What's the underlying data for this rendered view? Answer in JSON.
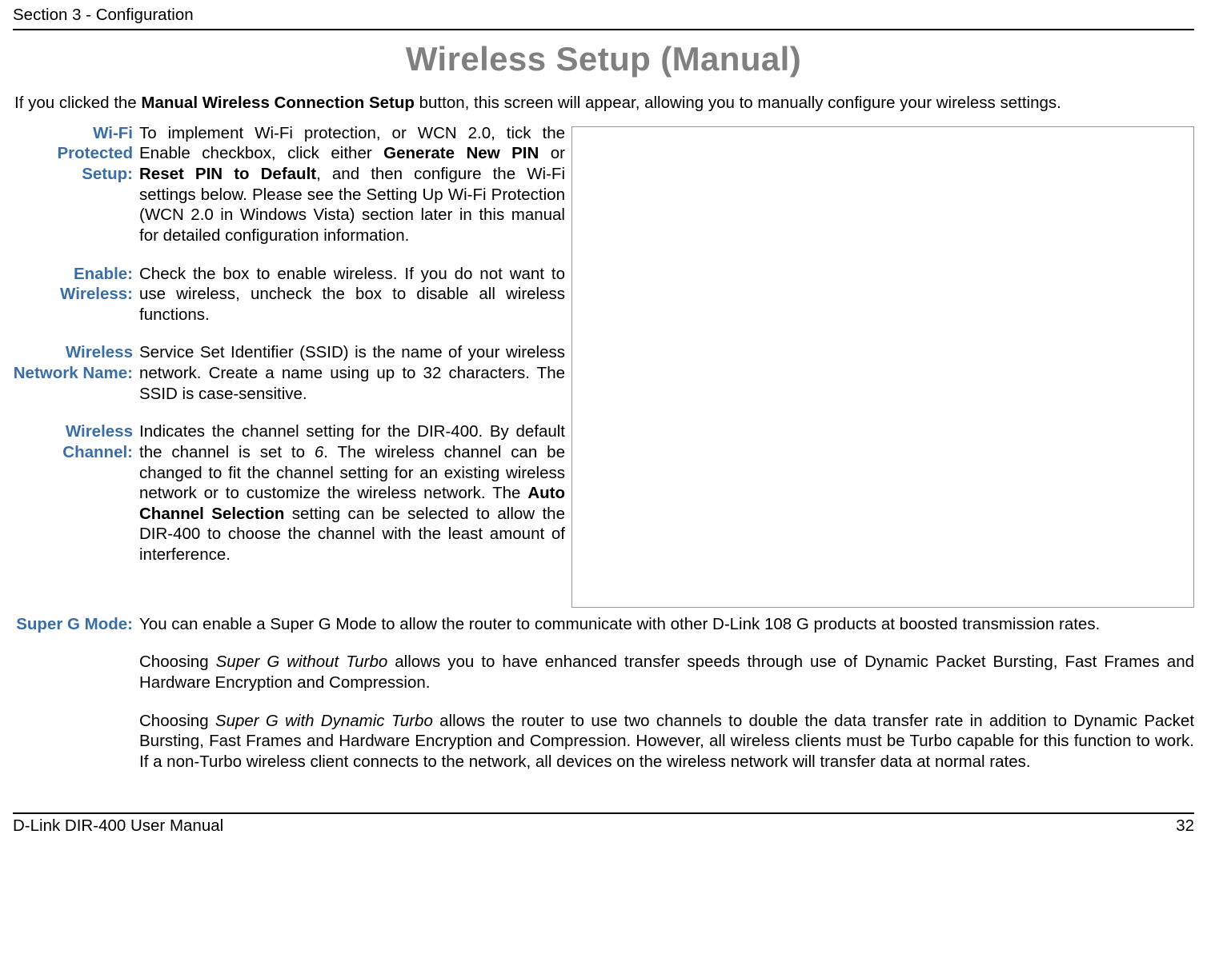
{
  "header": {
    "section": "Section 3 - Configuration"
  },
  "title": "Wireless Setup (Manual)",
  "intro_pre": "If you clicked the ",
  "intro_bold": "Manual Wireless Connection Setup",
  "intro_post": " button, this screen will appear, allowing you to manually configure your wireless settings.",
  "defs": {
    "wifi_protected": {
      "label1": "Wi-Fi Protected",
      "label2": "Setup:",
      "body_pre": "To implement Wi-Fi protection, or WCN 2.0, tick the Enable checkbox, click either ",
      "body_b1": "Generate New PIN",
      "body_mid1": " or ",
      "body_b2": "Reset PIN to Default",
      "body_post": ", and then configure the Wi-Fi settings below. Please see the Setting Up Wi-Fi Protection (WCN 2.0 in Windows Vista) section later in this manual for detailed configuration information."
    },
    "enable": {
      "label1": "Enable:",
      "label2": "Wireless:",
      "body": "Check the box to enable wireless. If you do not want to use wireless, uncheck the box to disable all wireless functions."
    },
    "netname": {
      "label1": "Wireless",
      "label2": "Network Name:",
      "body": "Service Set Identifier (SSID) is the name of your wireless network. Create a name using up to 32 characters. The SSID is case-sensitive."
    },
    "channel": {
      "label1": "Wireless",
      "label2": "Channel:",
      "body_pre": "Indicates the channel setting for the DIR-400. By default the channel is set to ",
      "body_i": "6",
      "body_mid": ". The wireless channel can be changed to fit the channel setting for an existing wireless network or to customize the wireless network. The ",
      "body_b": "Auto Channel Selection",
      "body_post": " setting can be selected to allow the DIR-400 to choose the channel with the least amount of interference."
    },
    "superg": {
      "label": "Super G Mode:",
      "p1": "You can enable a Super G Mode to allow the router to communicate with other D-Link 108 G products at boosted transmission rates.",
      "p2_pre": "Choosing ",
      "p2_i": "Super G without Turbo",
      "p2_post": " allows you to have enhanced transfer speeds through use of Dynamic Packet Bursting, Fast Frames and Hardware Encryption and Compression.",
      "p3_pre": "Choosing ",
      "p3_i": "Super G with Dynamic Turbo",
      "p3_post": " allows the router to use two channels to double the data transfer rate in addition to Dynamic Packet Bursting, Fast Frames and Hardware Encryption and Compression. However, all wireless clients must be Turbo capable for this function to work. If a non-Turbo wireless client connects to the network, all devices on the wireless network will transfer data at normal rates."
    }
  },
  "footer": {
    "left": "D-Link DIR-400 User Manual",
    "right": "32"
  }
}
